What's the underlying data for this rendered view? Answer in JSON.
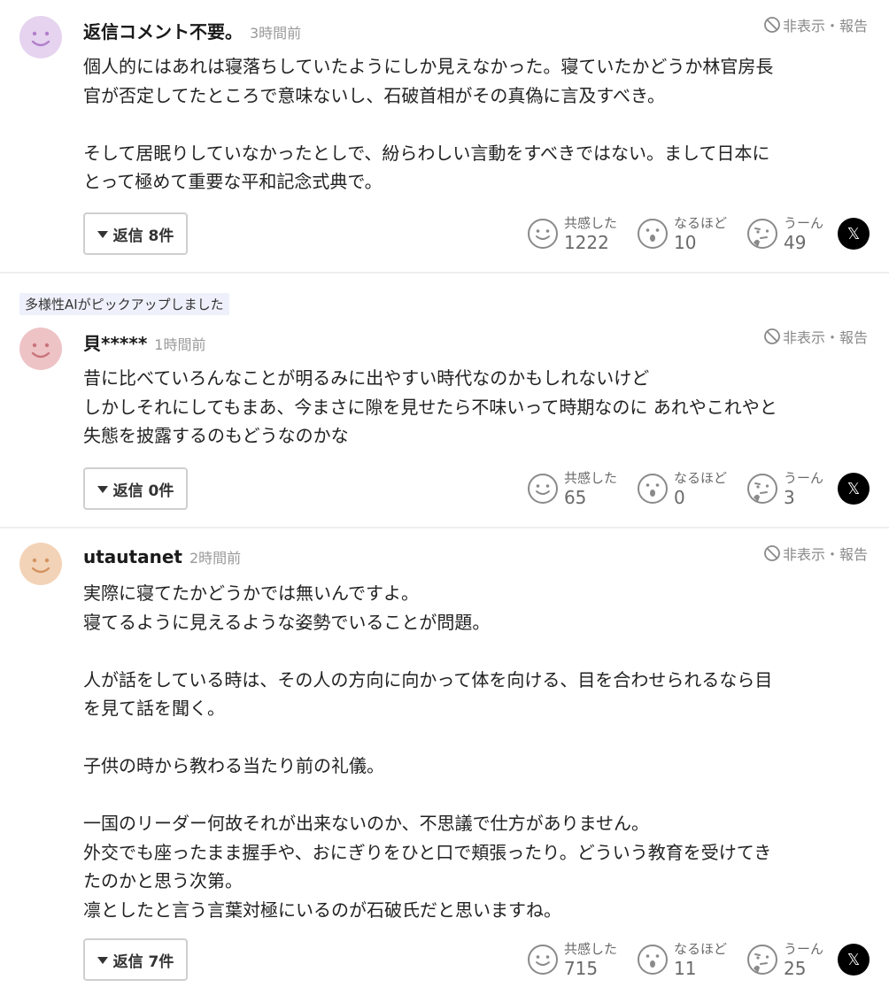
{
  "comments": [
    {
      "user": "返信コメント不要。",
      "time": "3時間前",
      "report": "非表示・報告",
      "lines": [
        "個人的にはあれは寝落ちしていたようにしか見えなかった。寝ていたかどうか林官房長",
        "官が否定してたところで意味ないし、石破首相がその真偽に言及すべき。",
        "",
        "そして居眠りしていなかったとしで、紛らわしい言動をすべきではない。まして日本に",
        "とって極めて重要な平和記念式典で。"
      ],
      "reply_label": "返信 8件",
      "reactions": [
        {
          "label": "共感した",
          "count": "1222"
        },
        {
          "label": "なるほど",
          "count": "10"
        },
        {
          "label": "うーん",
          "count": "49"
        }
      ],
      "share": "𝕏"
    },
    {
      "badge": "多様性AIがピックアップしました",
      "user": "貝*****",
      "time": "1時間前",
      "report": "非表示・報告",
      "lines": [
        "昔に比べていろんなことが明るみに出やすい時代なのかもしれないけど",
        "しかしそれにしてもまあ、今まさに隙を見せたら不味いって時期なのに あれやこれやと",
        "失態を披露するのもどうなのかな"
      ],
      "reply_label": "返信 0件",
      "reactions": [
        {
          "label": "共感した",
          "count": "65"
        },
        {
          "label": "なるほど",
          "count": "0"
        },
        {
          "label": "うーん",
          "count": "3"
        }
      ],
      "share": "𝕏"
    },
    {
      "user": "utautanet",
      "time": "2時間前",
      "report": "非表示・報告",
      "lines": [
        "実際に寝てたかどうかでは無いんですよ。",
        "寝てるように見えるような姿勢でいることが問題。",
        "",
        "人が話をしている時は、その人の方向に向かって体を向ける、目を合わせられるなら目",
        "を見て話を聞く。",
        "",
        "子供の時から教わる当たり前の礼儀。",
        "",
        "一国のリーダー何故それが出来ないのか、不思議で仕方がありません。",
        "外交でも座ったまま握手や、おにぎりをひと口で頬張ったり。どういう教育を受けてき",
        "たのかと思う次第。",
        "凛としたと言う言葉対極にいるのが石破氏だと思いますね。"
      ],
      "reply_label": "返信 7件",
      "reactions": [
        {
          "label": "共感した",
          "count": "715"
        },
        {
          "label": "なるほど",
          "count": "11"
        },
        {
          "label": "うーん",
          "count": "25"
        }
      ],
      "share": "𝕏"
    }
  ],
  "colors": {
    "avatar_purple": "#e6d3ef",
    "avatar_pink": "#eec3c6",
    "avatar_peach": "#f3d3b7"
  }
}
